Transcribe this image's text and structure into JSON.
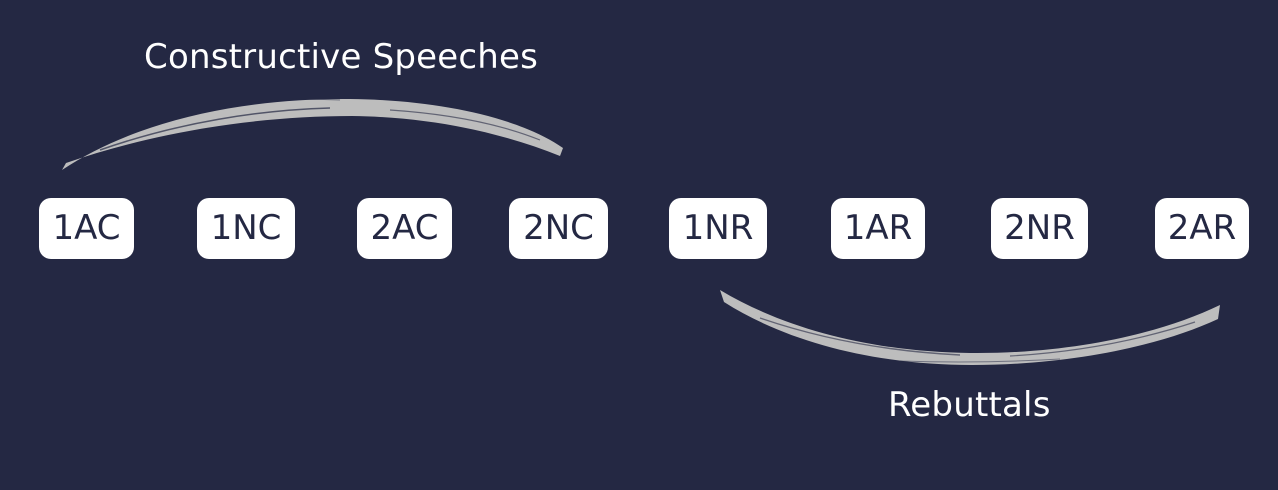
{
  "diagram": {
    "background_color": "#242843",
    "brush_color": "#bdbdbd",
    "top_group": {
      "label": "Constructive Speeches",
      "icon": "brush-stroke-arc"
    },
    "bottom_group": {
      "label": "Rebuttals",
      "icon": "brush-stroke-arc"
    },
    "speeches": [
      {
        "label": "1AC"
      },
      {
        "label": "1NC"
      },
      {
        "label": "2AC"
      },
      {
        "label": "2NC"
      },
      {
        "label": "1NR"
      },
      {
        "label": "1AR"
      },
      {
        "label": "2NR"
      },
      {
        "label": "2AR"
      }
    ]
  }
}
